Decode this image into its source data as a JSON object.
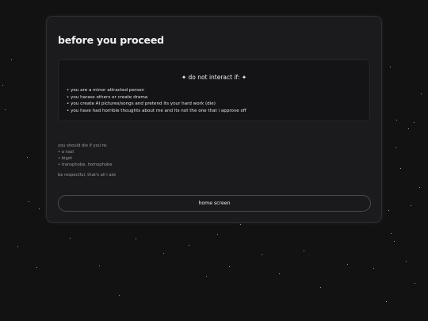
{
  "page": {
    "title": "before you proceed"
  },
  "warning": {
    "heading": "✦ do not interact if: ✦",
    "items": [
      "• you are a minor attracted person",
      "• you harass others or create drama",
      "• you create AI pictures/songs and pretend its your hard work (die)",
      "• you have had horrible thoughts about me and its not the one that i approve off"
    ]
  },
  "dislikes": {
    "intro": "you should die if you're:",
    "items": [
      "• a nazi",
      "• bigot",
      "• transphobe, homophobe"
    ]
  },
  "closing": "be respectful, that's all i ask",
  "button": {
    "label": "home screen"
  },
  "colors": {
    "background": "#121212",
    "card": "#1b1b1d",
    "warning_box": "#141416",
    "title_text": "#f2f2f2",
    "muted_text": "#9a9a9a",
    "button_border": "#4a4a4f"
  }
}
